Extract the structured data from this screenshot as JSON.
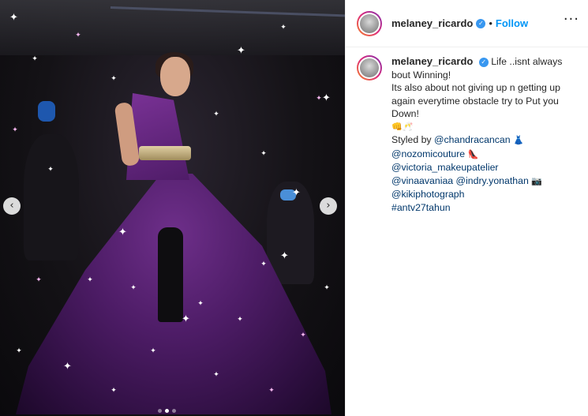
{
  "post": {
    "carousel": {
      "prev_icon": "‹",
      "next_icon": "›",
      "slides": 3,
      "active_slide": 2
    }
  },
  "header": {
    "username": "melaney_ricardo",
    "verified_icon": "✓",
    "separator": "•",
    "follow_label": "Follow",
    "more_icon": "···"
  },
  "caption": {
    "username": "melaney_ricardo",
    "verified_icon": "✓",
    "line1": "Life ..isnt always bout Winning!",
    "line2": "Its also about not giving up n getting up again everytime obstacle try to Put you Down!",
    "emoji_line": "👊🥂",
    "styled_by": "Styled by",
    "mention1": "@chandracancan",
    "emoji1": "👗",
    "mention2": "@nozomicouture",
    "emoji2": "👠",
    "mention3": "@victoria_makeupatelier",
    "mention4": "@vinaavaniaa",
    "mention5": "@indry.yonathan",
    "emoji3": "📷",
    "mention6": "@kikiphotograph",
    "hashtag": "#antv27tahun"
  },
  "colors": {
    "accent": "#0095f6",
    "link": "#00376b",
    "verified": "#3897f0",
    "text": "#262626"
  }
}
